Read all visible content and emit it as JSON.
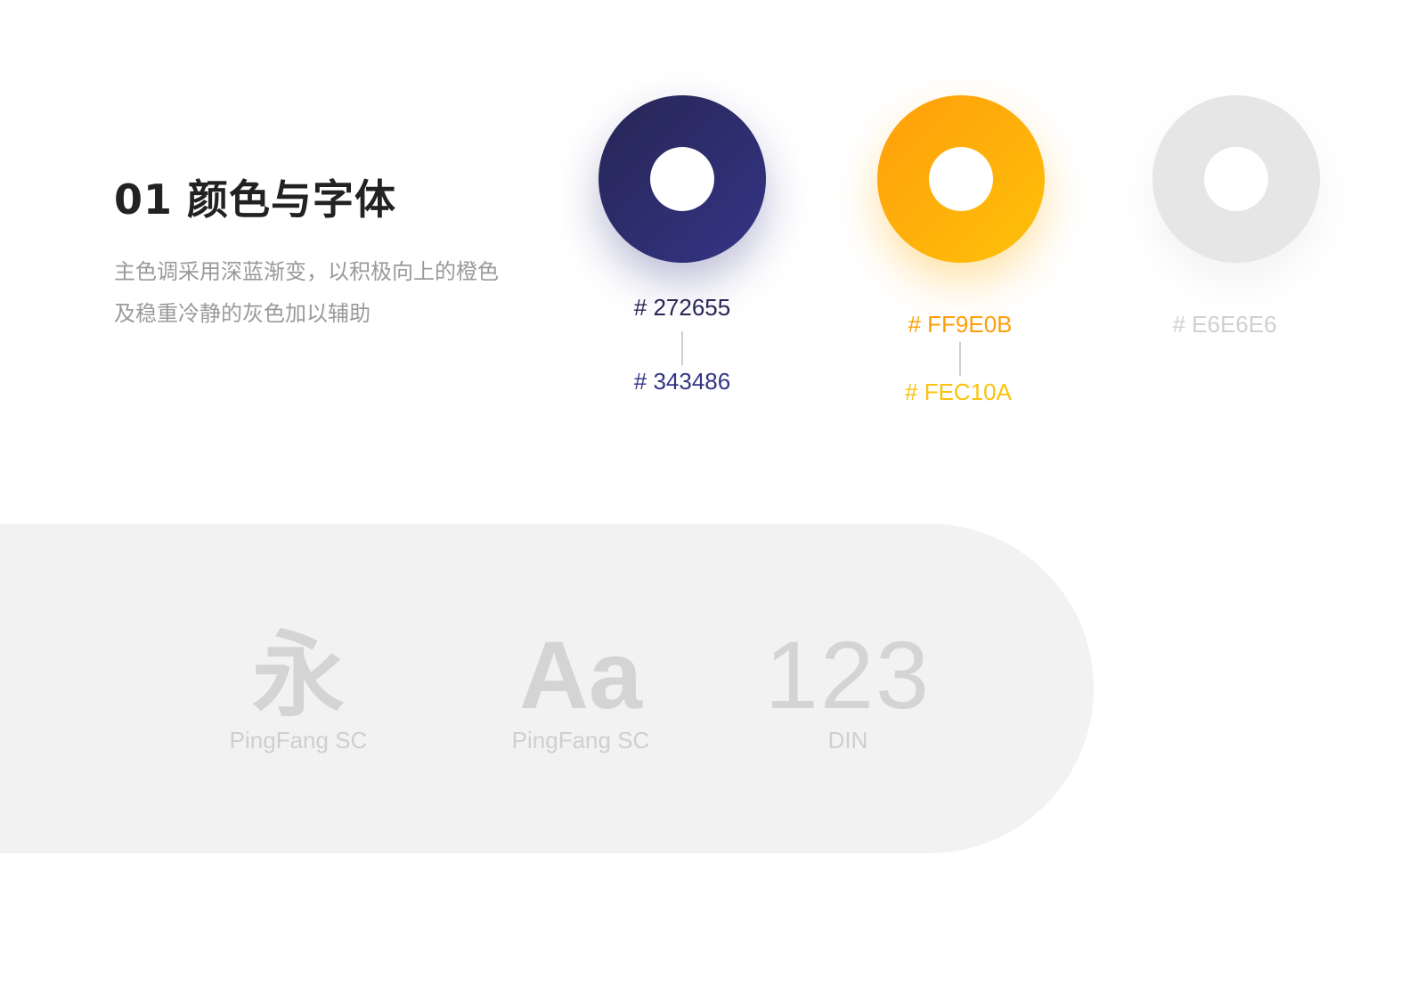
{
  "section": {
    "number": "01",
    "title": "颜色与字体",
    "description_lines": [
      "主色调采用深蓝渐变，以积极向上的橙色",
      "及稳重冷静的灰色加以辅助"
    ]
  },
  "palette": {
    "navy": {
      "from_label": "# 272655",
      "to_label": "# 343486",
      "colors": [
        "#272655",
        "#343486"
      ]
    },
    "orange": {
      "from_label": "# FF9E0B",
      "to_label": "# FEC10A",
      "colors": [
        "#FF9E0B",
        "#FEC10A"
      ]
    },
    "gray": {
      "label": "# E6E6E6",
      "colors": [
        "#E6E6E6"
      ]
    }
  },
  "fonts": [
    {
      "glyph": "永",
      "name": "PingFang SC"
    },
    {
      "glyph": "Aa",
      "name": "PingFang SC"
    },
    {
      "glyph": "123",
      "name": "DIN"
    }
  ]
}
